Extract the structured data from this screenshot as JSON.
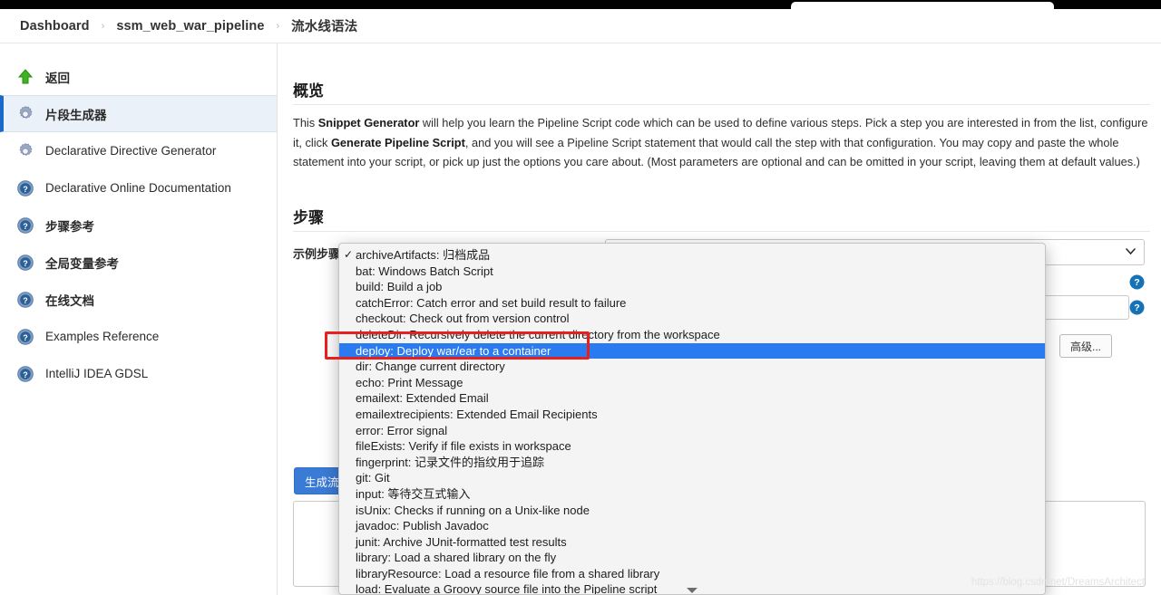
{
  "breadcrumb": {
    "items": [
      "Dashboard",
      "ssm_web_war_pipeline",
      "流水线语法"
    ],
    "separator": "›"
  },
  "sidebar": {
    "items": [
      {
        "label": "返回",
        "icon": "up-arrow-icon",
        "selected": false
      },
      {
        "label": "片段生成器",
        "icon": "gear-icon",
        "selected": true
      },
      {
        "label": "Declarative Directive Generator",
        "icon": "gear-icon",
        "selected": false
      },
      {
        "label": "Declarative Online Documentation",
        "icon": "help-icon",
        "selected": false
      },
      {
        "label": "步骤参考",
        "icon": "help-icon",
        "selected": false
      },
      {
        "label": "全局变量参考",
        "icon": "help-icon",
        "selected": false
      },
      {
        "label": "在线文档",
        "icon": "help-icon",
        "selected": false
      },
      {
        "label": "Examples Reference",
        "icon": "help-icon",
        "selected": false
      },
      {
        "label": "IntelliJ IDEA GDSL",
        "icon": "help-icon",
        "selected": false
      }
    ]
  },
  "main": {
    "overview_heading": "概览",
    "overview_p1_a": "This ",
    "overview_p1_b": "Snippet Generator",
    "overview_p1_c": " will help you learn the Pipeline Script code which can be used to define various steps. Pick a step you are interested in from the list, configure it, click ",
    "overview_p1_d": "Generate Pipeline Script",
    "overview_p1_e": ", and you will see a Pipeline Script statement that would call the step with that configuration. You may copy and paste the whole statement into your script, or pick up just the options you care about. (Most parameters are optional and can be omitted in your script, leaving them at default values.)",
    "steps_heading": "步骤",
    "sample_step_label": "示例步骤",
    "advanced_button": "高级...",
    "generate_button": "生成流水线脚本",
    "select_value": ""
  },
  "dropdown": {
    "items": [
      {
        "label": "archiveArtifacts: 归档成品",
        "checked": true,
        "selected": false
      },
      {
        "label": "bat: Windows Batch Script",
        "checked": false,
        "selected": false
      },
      {
        "label": "build: Build a job",
        "checked": false,
        "selected": false
      },
      {
        "label": "catchError: Catch error and set build result to failure",
        "checked": false,
        "selected": false
      },
      {
        "label": "checkout: Check out from version control",
        "checked": false,
        "selected": false
      },
      {
        "label": "deleteDir: Recursively delete the current directory from the workspace",
        "checked": false,
        "selected": false
      },
      {
        "label": "deploy: Deploy war/ear to a container",
        "checked": false,
        "selected": true
      },
      {
        "label": "dir: Change current directory",
        "checked": false,
        "selected": false
      },
      {
        "label": "echo: Print Message",
        "checked": false,
        "selected": false
      },
      {
        "label": "emailext: Extended Email",
        "checked": false,
        "selected": false
      },
      {
        "label": "emailextrecipients: Extended Email Recipients",
        "checked": false,
        "selected": false
      },
      {
        "label": "error: Error signal",
        "checked": false,
        "selected": false
      },
      {
        "label": "fileExists: Verify if file exists in workspace",
        "checked": false,
        "selected": false
      },
      {
        "label": "fingerprint: 记录文件的指纹用于追踪",
        "checked": false,
        "selected": false
      },
      {
        "label": "git: Git",
        "checked": false,
        "selected": false
      },
      {
        "label": "input: 等待交互式输入",
        "checked": false,
        "selected": false
      },
      {
        "label": "isUnix: Checks if running on a Unix-like node",
        "checked": false,
        "selected": false
      },
      {
        "label": "javadoc: Publish Javadoc",
        "checked": false,
        "selected": false
      },
      {
        "label": "junit: Archive JUnit-formatted test results",
        "checked": false,
        "selected": false
      },
      {
        "label": "library: Load a shared library on the fly",
        "checked": false,
        "selected": false
      },
      {
        "label": "libraryResource: Load a resource file from a shared library",
        "checked": false,
        "selected": false
      },
      {
        "label": "load: Evaluate a Groovy source file into the Pipeline script",
        "checked": false,
        "selected": false
      }
    ],
    "check_glyph": "✓"
  },
  "watermark": "https://blog.csdn.net/DreamsArchitect",
  "colors": {
    "accent_blue": "#1b6ac9",
    "highlight_blue": "#2a7bf0",
    "annotation_red": "#e81f1f",
    "button_blue": "#3a7bd5"
  }
}
